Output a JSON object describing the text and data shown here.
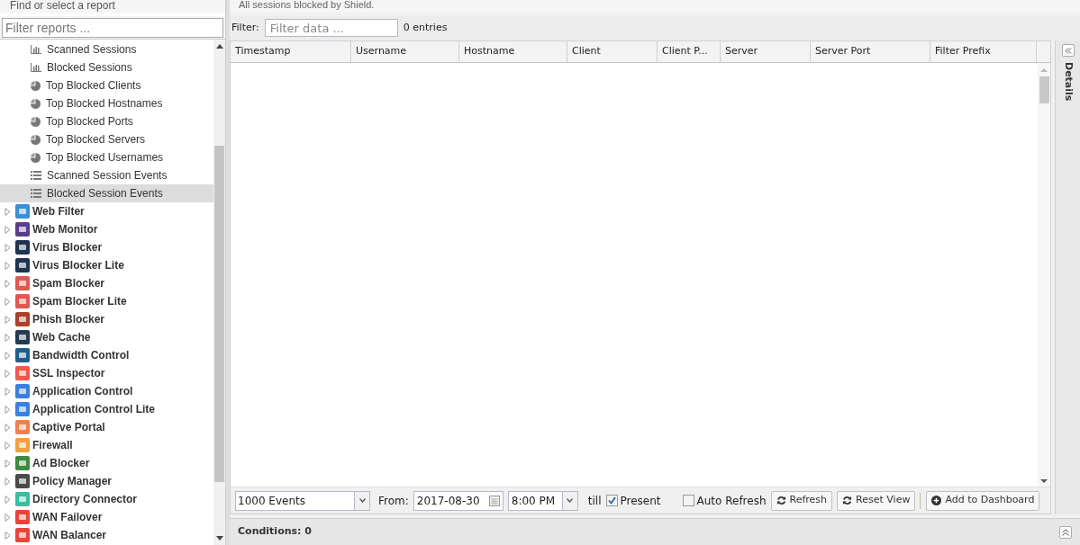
{
  "sidebar": {
    "title": "Find or select a report",
    "search": {
      "placeholder": "Filter reports ..."
    },
    "items": [
      {
        "kind": "bar",
        "label": "Scanned Sessions",
        "selected": false
      },
      {
        "kind": "bar",
        "label": "Blocked Sessions",
        "selected": false
      },
      {
        "kind": "pie",
        "label": "Top Blocked Clients",
        "selected": false
      },
      {
        "kind": "pie",
        "label": "Top Blocked Hostnames",
        "selected": false
      },
      {
        "kind": "pie",
        "label": "Top Blocked Ports",
        "selected": false
      },
      {
        "kind": "pie",
        "label": "Top Blocked Servers",
        "selected": false
      },
      {
        "kind": "pie",
        "label": "Top Blocked Usernames",
        "selected": false
      },
      {
        "kind": "list",
        "label": "Scanned Session Events",
        "selected": false
      },
      {
        "kind": "list",
        "label": "Blocked Session Events",
        "selected": true
      },
      {
        "kind": "app",
        "label": "Web Filter",
        "color": "#3a8fd8",
        "expanded": false
      },
      {
        "kind": "app",
        "label": "Web Monitor",
        "color": "#5a3d8f",
        "expanded": false
      },
      {
        "kind": "app",
        "label": "Virus Blocker",
        "color": "#1f3550",
        "expanded": false
      },
      {
        "kind": "app",
        "label": "Virus Blocker Lite",
        "color": "#1f3550",
        "expanded": false
      },
      {
        "kind": "app",
        "label": "Spam Blocker",
        "color": "#e0584f",
        "expanded": false
      },
      {
        "kind": "app",
        "label": "Spam Blocker Lite",
        "color": "#e0584f",
        "expanded": false
      },
      {
        "kind": "app",
        "label": "Phish Blocker",
        "color": "#a8432a",
        "expanded": false
      },
      {
        "kind": "app",
        "label": "Web Cache",
        "color": "#263a55",
        "expanded": false
      },
      {
        "kind": "app",
        "label": "Bandwidth Control",
        "color": "#1e5f8c",
        "expanded": false
      },
      {
        "kind": "app",
        "label": "SSL Inspector",
        "color": "#f2574b",
        "expanded": false
      },
      {
        "kind": "app",
        "label": "Application Control",
        "color": "#3b7fe0",
        "expanded": false
      },
      {
        "kind": "app",
        "label": "Application Control Lite",
        "color": "#3b7fe0",
        "expanded": false
      },
      {
        "kind": "app",
        "label": "Captive Portal",
        "color": "#f2804a",
        "expanded": false
      },
      {
        "kind": "app",
        "label": "Firewall",
        "color": "#f0a040",
        "expanded": false
      },
      {
        "kind": "app",
        "label": "Ad Blocker",
        "color": "#3d8a3f",
        "expanded": false
      },
      {
        "kind": "app",
        "label": "Policy Manager",
        "color": "#4a4a4a",
        "expanded": false
      },
      {
        "kind": "app",
        "label": "Directory Connector",
        "color": "#36c0a0",
        "expanded": false
      },
      {
        "kind": "app",
        "label": "WAN Failover",
        "color": "#e8453a",
        "expanded": false
      },
      {
        "kind": "app",
        "label": "WAN Balancer",
        "color": "#e8453a",
        "expanded": false
      }
    ]
  },
  "description": "All sessions blocked by Shield.",
  "filter": {
    "label": "Filter:",
    "placeholder": "Filter data ...",
    "count": "0 entries"
  },
  "table": {
    "columns": [
      "Timestamp",
      "Username",
      "Hostname",
      "Client",
      "Client P...",
      "Server",
      "Server Port",
      "Filter Prefix"
    ]
  },
  "details_panel": {
    "title": "Details"
  },
  "toolbar": {
    "limit": "1000 Events",
    "from_label": "From:",
    "date": "2017-08-30",
    "time": "8:00 PM",
    "till_label": "till",
    "present": {
      "label": "Present",
      "checked": true
    },
    "auto_refresh": {
      "label": "Auto Refresh",
      "checked": false
    },
    "buttons": [
      {
        "kind": "refresh",
        "label": "Refresh"
      },
      {
        "kind": "refresh",
        "label": "Reset View"
      },
      {
        "kind": "add",
        "label": "Add to Dashboard"
      }
    ]
  },
  "conditions": "Conditions: 0"
}
